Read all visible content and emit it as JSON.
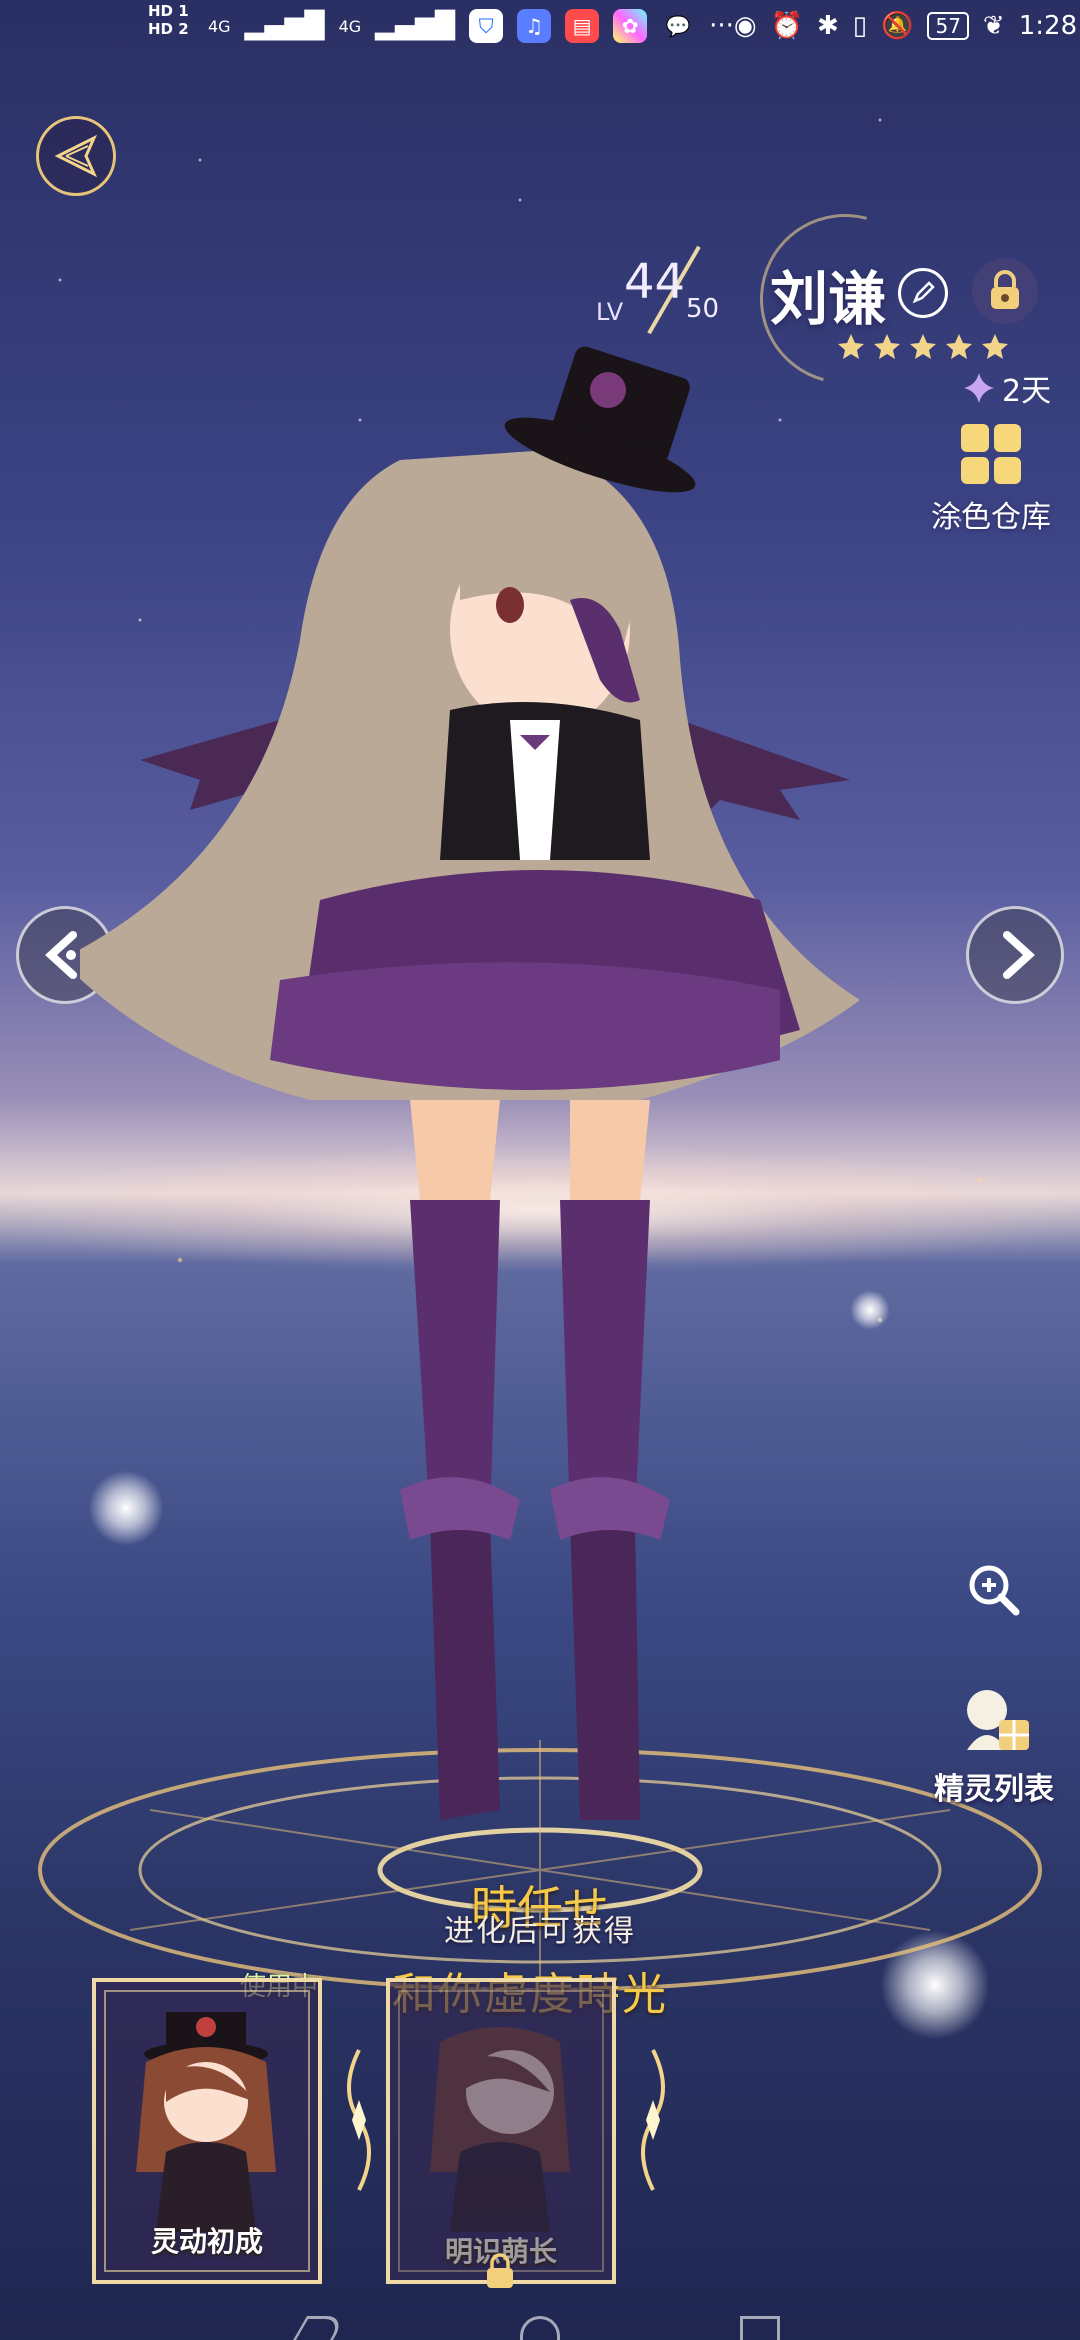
{
  "status_bar": {
    "hd1": "HD 1",
    "hd2": "HD 2",
    "network_1": "4G",
    "network_2": "4G",
    "more": "···",
    "battery": "57",
    "time": "1:28"
  },
  "profile": {
    "lv_label": "LV",
    "level_current": "44",
    "level_max": "50",
    "name": "刘谦",
    "star_count": 5,
    "days": "2天"
  },
  "side_menu": {
    "wardrobe_label": "涂色仓库",
    "sprite_list_label": "精灵列表"
  },
  "outfit": {
    "title": "時任せ",
    "unlock_hint": "进化后可获得",
    "subtitle": "和你虛度時光"
  },
  "cards": [
    {
      "label": "灵动初成",
      "status": "使用中"
    },
    {
      "label": "明识萌长",
      "locked": true
    }
  ],
  "colors": {
    "gold": "#f6c94a",
    "frame": "#efd9a4",
    "accent_purple": "#5b2f6e"
  }
}
